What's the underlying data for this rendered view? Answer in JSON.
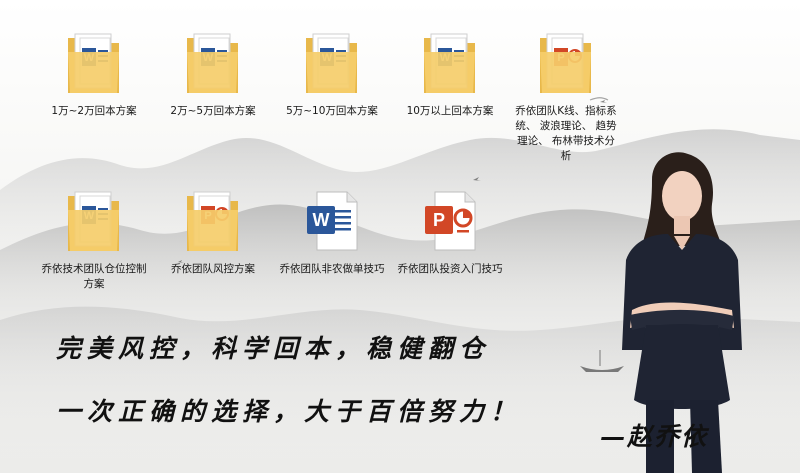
{
  "files": [
    {
      "name": "1万~2万回本方案",
      "type": "word-folder"
    },
    {
      "name": "2万~5万回本方案",
      "type": "word-folder"
    },
    {
      "name": "5万~10万回本方案",
      "type": "word-folder"
    },
    {
      "name": "10万以上回本方案",
      "type": "word-folder"
    },
    {
      "name": "乔依团队K线、指标系统、 波浪理论、 趋势理论、 布林带技术分析",
      "type": "powerpoint-folder"
    },
    {
      "name": "乔依技术团队仓位控制方案",
      "type": "word-folder"
    },
    {
      "name": "乔依团队风控方案",
      "type": "powerpoint-folder"
    },
    {
      "name": "乔依团队非农做单技巧",
      "type": "word-document"
    },
    {
      "name": "乔依团队投资入门技巧",
      "type": "powerpoint-document"
    }
  ],
  "slogan": {
    "line1": "完美风控，科学回本，稳健翻仓",
    "line2": "一次正确的选择，大于百倍努力！",
    "signature": "—赵乔依"
  },
  "colors": {
    "folder": "#f5cd6a",
    "folder_dark": "#e8b84a",
    "word_blue": "#2b579a",
    "powerpoint_red": "#d24726",
    "text": "#1a1a1a"
  }
}
